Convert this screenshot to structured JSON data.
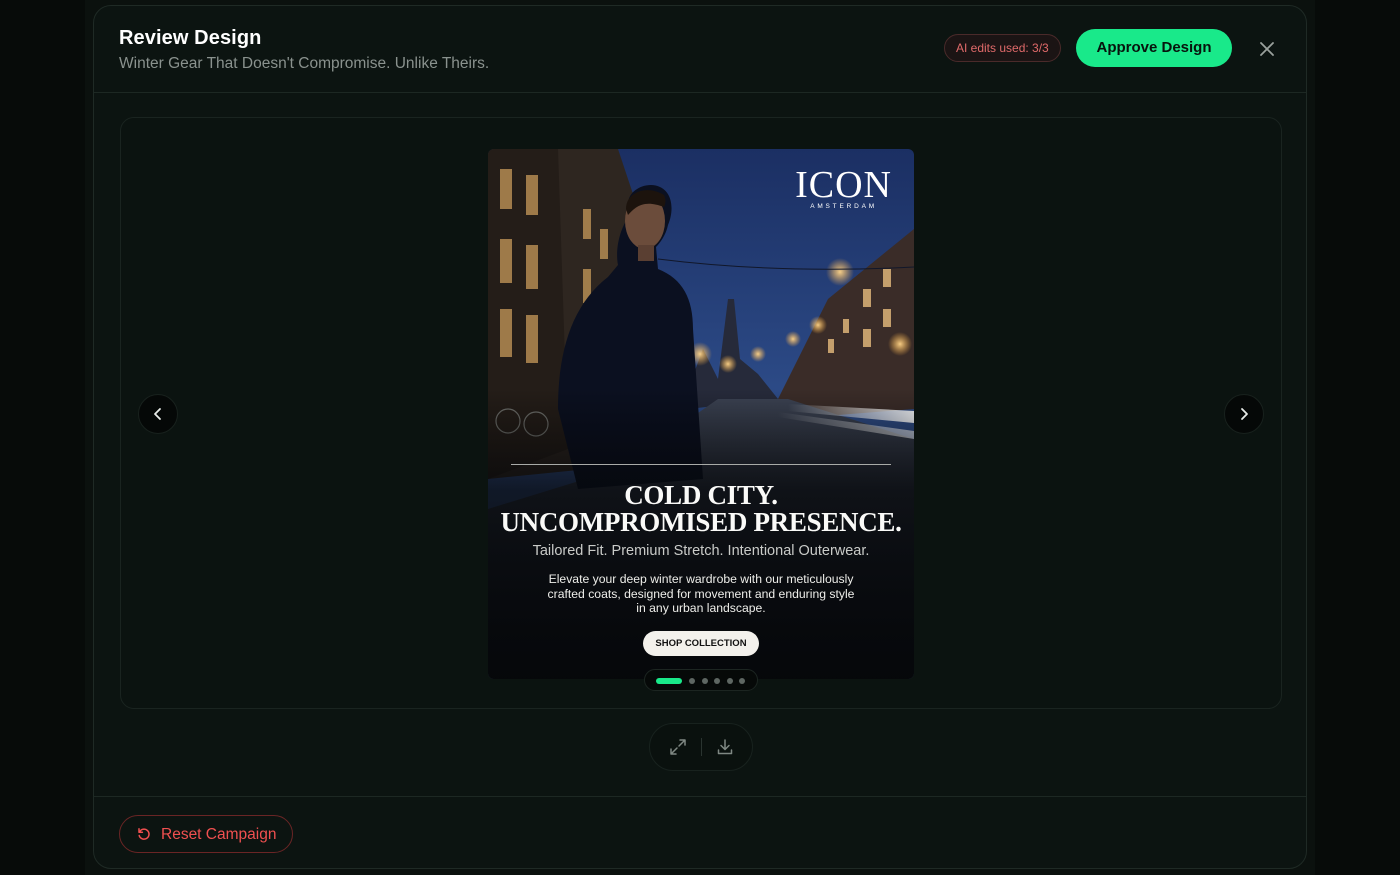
{
  "header": {
    "title": "Review Design",
    "subtitle": "Winter Gear That Doesn't Compromise. Unlike Theirs.",
    "ai_edits_label": "AI edits used: 3/3",
    "approve_label": "Approve Design",
    "close_icon": "close-icon"
  },
  "carousel": {
    "prev_icon": "chevron-left-icon",
    "next_icon": "chevron-right-icon",
    "slide_count": 6,
    "active_slide": 1
  },
  "ad": {
    "brand_name": "ICON",
    "brand_sub": "AMSTERDAM",
    "headline_line1": "COLD CITY.",
    "headline_line2": "UNCOMPROMISED PRESENCE.",
    "tagline": "Tailored Fit. Premium Stretch. Intentional Outerwear.",
    "body_line1": "Elevate your deep winter wardrobe with our meticulously",
    "body_line2": "crafted coats, designed for movement and enduring style",
    "body_line3": "in any urban landscape.",
    "cta_label": "SHOP COLLECTION"
  },
  "toolbar": {
    "expand_icon": "expand-icon",
    "download_icon": "download-icon"
  },
  "footer": {
    "reset_label": "Reset Campaign",
    "reset_icon": "reset-icon"
  },
  "colors": {
    "accent": "#19e98a",
    "danger": "#f05050",
    "background": "#0c1411"
  }
}
